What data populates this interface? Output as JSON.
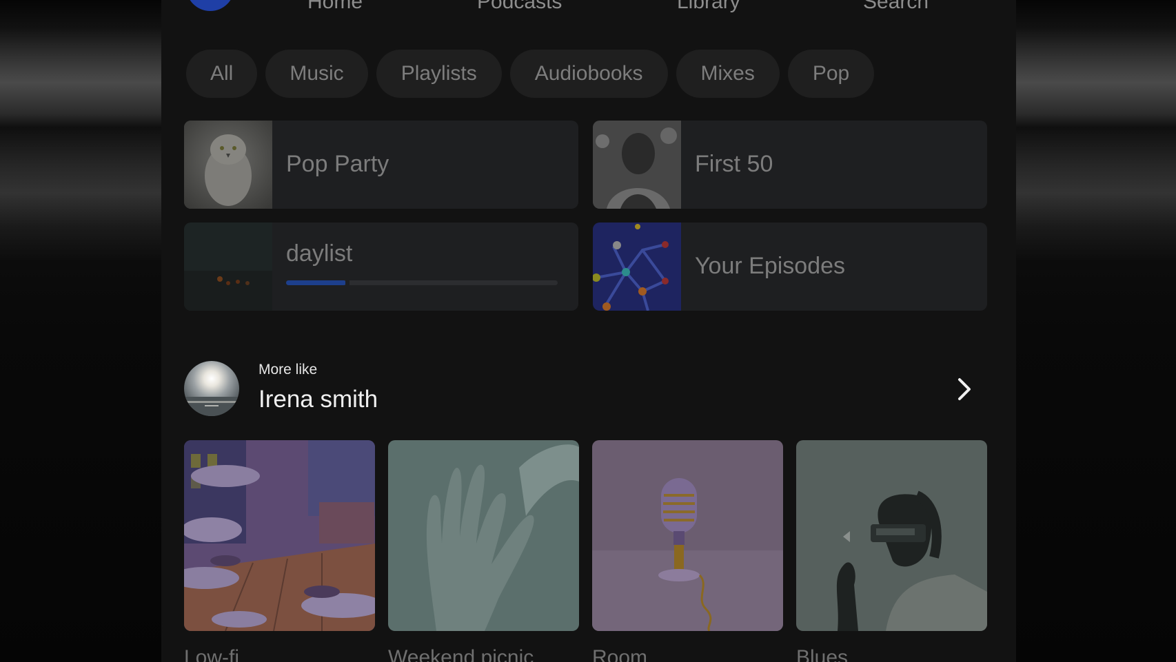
{
  "nav": {
    "items": [
      "Home",
      "Podcasts",
      "Library",
      "Search"
    ]
  },
  "filters": [
    "All",
    "Music",
    "Playlists",
    "Audiobooks",
    "Mixes",
    "Pop"
  ],
  "shortcuts": [
    {
      "title": "Pop Party"
    },
    {
      "title": "First 50"
    },
    {
      "title": "daylist",
      "progress": 0.22
    },
    {
      "title": "Your Episodes"
    }
  ],
  "more_like": {
    "label": "More like",
    "artist": "Irena smith"
  },
  "playlists": [
    {
      "title": "Low-fi"
    },
    {
      "title": "Weekend picnic"
    },
    {
      "title": "Room"
    },
    {
      "title": "Blues"
    }
  ],
  "colors": {
    "accent": "#1f3fa6",
    "background": "#121212",
    "card": "#1e1f21"
  },
  "icons": {
    "next": "chevron-right-icon"
  }
}
